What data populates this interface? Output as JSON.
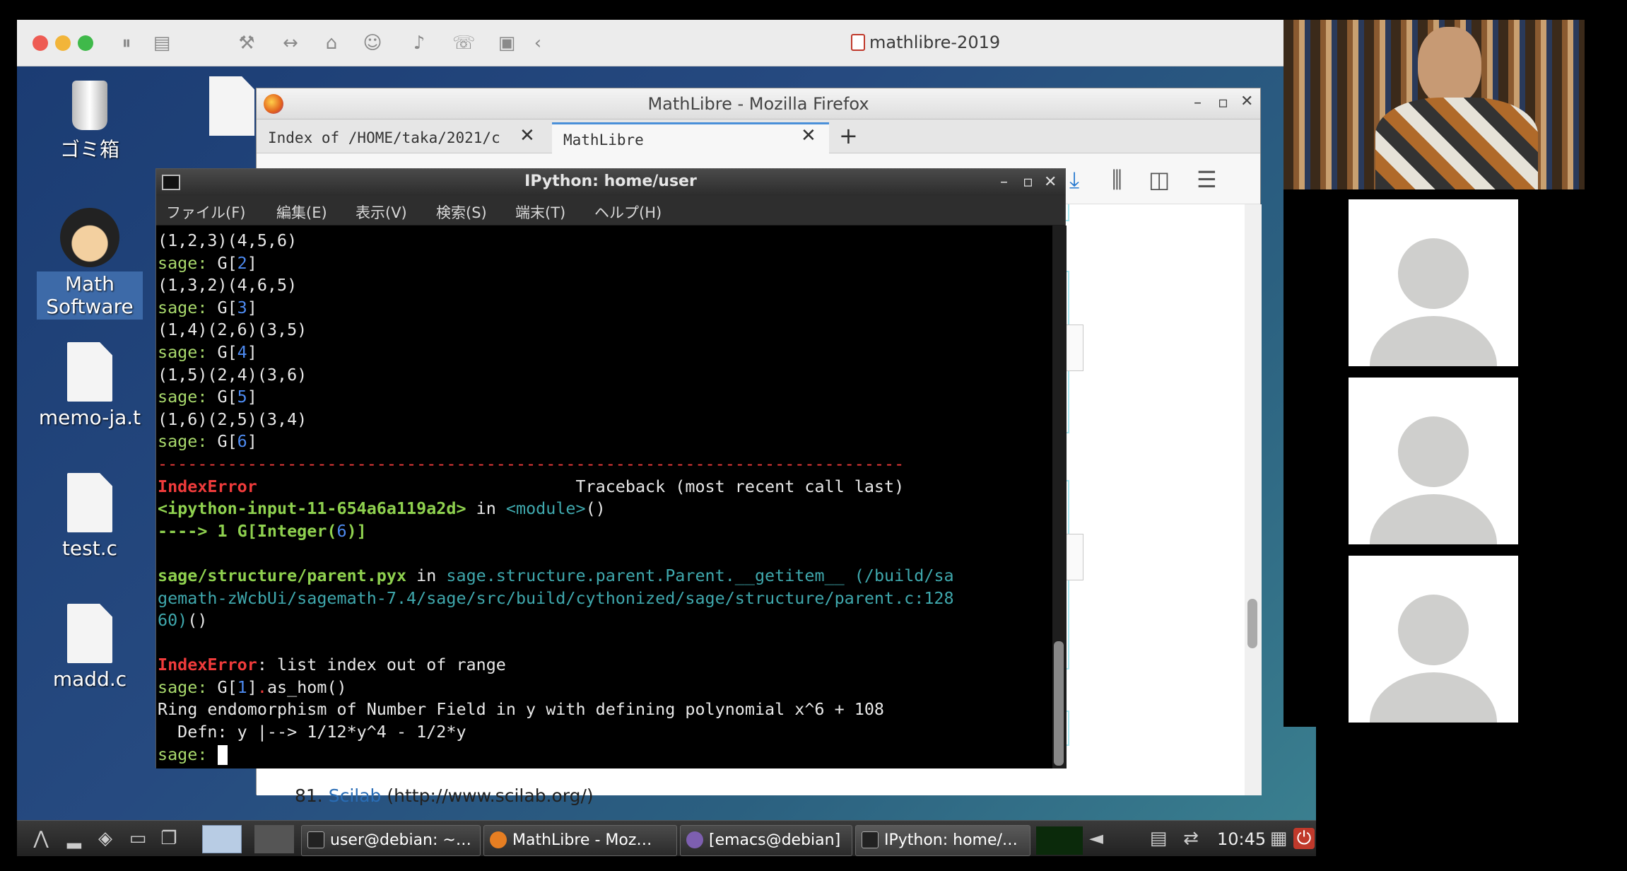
{
  "vm": {
    "title": "mathlibre-2019"
  },
  "desktop": {
    "icons": [
      {
        "label": "ゴミ箱"
      },
      {
        "label": "Math\nSoftware"
      },
      {
        "label": "memo-ja.t"
      },
      {
        "label": "test.c"
      },
      {
        "label": "madd.c"
      }
    ]
  },
  "firefox": {
    "title": "MathLibre - Mozilla Firefox",
    "tabs": [
      {
        "label": "Index of /HOME/taka/2021/c"
      },
      {
        "label": "MathLibre"
      }
    ],
    "list_item": {
      "number": "81.",
      "link": "Scilab",
      "url": "(http://www.scilab.org/)"
    }
  },
  "terminal": {
    "title": "IPython: home/user",
    "menu": [
      "ファイル(F)",
      "編集(E)",
      "表示(V)",
      "検索(S)",
      "端末(T)",
      "ヘルプ(H)"
    ],
    "lines": [
      "(1,2,3)(4,5,6)",
      "sage: G[2]",
      "(1,3,2)(4,6,5)",
      "sage: G[3]",
      "(1,4)(2,6)(3,5)",
      "sage: G[4]",
      "(1,5)(2,4)(3,6)",
      "sage: G[5]",
      "(1,6)(2,5)(3,4)",
      "sage: G[6]",
      "---------------------------------------------------------------------------",
      "IndexError                                Traceback (most recent call last)",
      "<ipython-input-11-654a6a119a2d> in <module>()",
      "----> 1 G[Integer(6)]",
      "",
      "sage/structure/parent.pyx in sage.structure.parent.Parent.__getitem__ (/build/sa",
      "gemath-zWcbUi/sagemath-7.4/sage/src/build/cythonized/sage/structure/parent.c:128",
      "60)()",
      "",
      "IndexError: list index out of range",
      "sage: G[1].as_hom()",
      "Ring endomorphism of Number Field in y with defining polynomial x^6 + 108",
      "  Defn: y |--> 1/12*y^4 - 1/2*y",
      "sage: "
    ]
  },
  "taskbar": {
    "tasks": [
      "user@debian: ~…",
      "MathLibre - Moz…",
      "[emacs@debian]",
      "IPython: home/…"
    ],
    "clock": "10:45"
  },
  "colors": {
    "prompt": "#a8d96c",
    "error": "#ef3b3b",
    "cyan": "#3fa8ad",
    "link": "#2a6db5"
  }
}
